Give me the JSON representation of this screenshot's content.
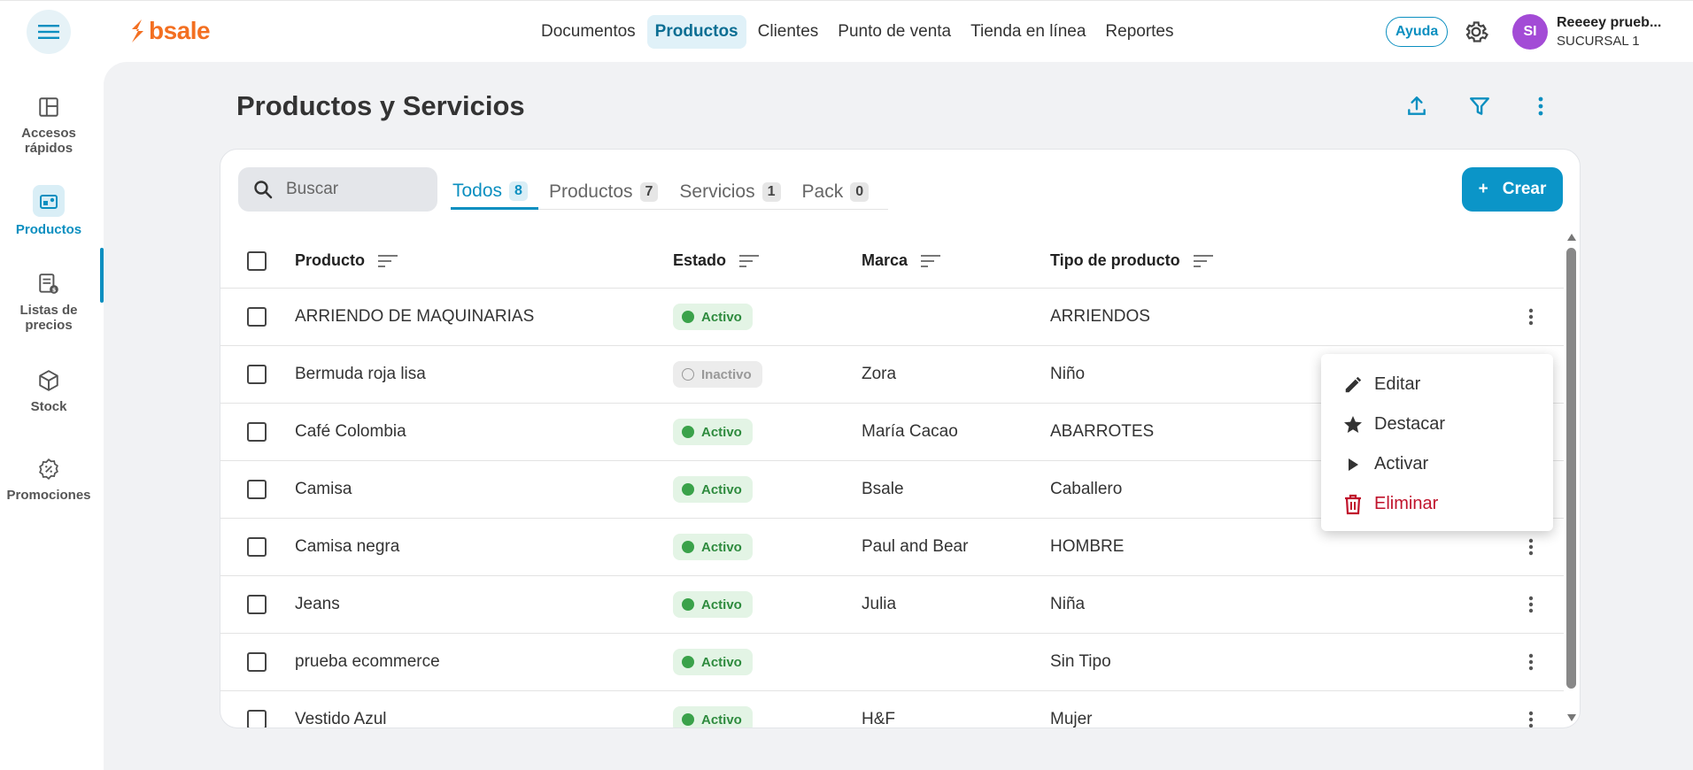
{
  "topbar": {
    "logo_text": "bsale",
    "nav": [
      {
        "label": "Documentos",
        "active": false
      },
      {
        "label": "Productos",
        "active": true
      },
      {
        "label": "Clientes",
        "active": false
      },
      {
        "label": "Punto de venta",
        "active": false
      },
      {
        "label": "Tienda en línea",
        "active": false
      },
      {
        "label": "Reportes",
        "active": false
      }
    ],
    "help_label": "Ayuda",
    "user": {
      "initials": "SI",
      "name": "Reeeey prueb...",
      "branch": "SUCURSAL 1"
    }
  },
  "sidebar": {
    "items": [
      {
        "label_line1": "Accesos",
        "label_line2": "rápidos",
        "icon": "dashboard-icon"
      },
      {
        "label_line1": "Productos",
        "label_line2": "",
        "icon": "products-icon",
        "active": true
      },
      {
        "label_line1": "Listas de",
        "label_line2": "precios",
        "icon": "price-list-icon"
      },
      {
        "label_line1": "Stock",
        "label_line2": "",
        "icon": "cube-icon"
      },
      {
        "label_line1": "Promociones",
        "label_line2": "",
        "icon": "discount-badge-icon"
      }
    ]
  },
  "page": {
    "title": "Productos y Servicios"
  },
  "search": {
    "placeholder": "Buscar"
  },
  "tabs": [
    {
      "label": "Todos",
      "count": "8",
      "active": true
    },
    {
      "label": "Productos",
      "count": "7",
      "active": false
    },
    {
      "label": "Servicios",
      "count": "1",
      "active": false
    },
    {
      "label": "Pack",
      "count": "0",
      "active": false
    }
  ],
  "create_button": {
    "icon": "+",
    "label": "Crear"
  },
  "table": {
    "columns": [
      "Producto",
      "Estado",
      "Marca",
      "Tipo de producto"
    ],
    "rows": [
      {
        "producto": "ARRIENDO DE MAQUINARIAS",
        "estado": "Activo",
        "marca": "",
        "tipo": "ARRIENDOS"
      },
      {
        "producto": "Bermuda roja lisa",
        "estado": "Inactivo",
        "marca": "Zora",
        "tipo": "Niño"
      },
      {
        "producto": "Café Colombia",
        "estado": "Activo",
        "marca": "María Cacao",
        "tipo": "ABARROTES"
      },
      {
        "producto": "Camisa",
        "estado": "Activo",
        "marca": "Bsale",
        "tipo": "Caballero"
      },
      {
        "producto": "Camisa negra",
        "estado": "Activo",
        "marca": "Paul and Bear",
        "tipo": "HOMBRE"
      },
      {
        "producto": "Jeans",
        "estado": "Activo",
        "marca": "Julia",
        "tipo": "Niña"
      },
      {
        "producto": "prueba ecommerce",
        "estado": "Activo",
        "marca": "",
        "tipo": "Sin Tipo"
      },
      {
        "producto": "Vestido Azul",
        "estado": "Activo",
        "marca": "H&F",
        "tipo": "Mujer"
      }
    ]
  },
  "context_menu": {
    "items": [
      {
        "label": "Editar",
        "icon": "pencil-icon"
      },
      {
        "label": "Destacar",
        "icon": "star-icon"
      },
      {
        "label": "Activar",
        "icon": "play-icon"
      },
      {
        "label": "Eliminar",
        "icon": "trash-icon"
      }
    ]
  },
  "colors": {
    "accent": "#0b95c8",
    "brand": "#f36f21",
    "active_status": "#3aa24a",
    "danger": "#c0132c"
  }
}
